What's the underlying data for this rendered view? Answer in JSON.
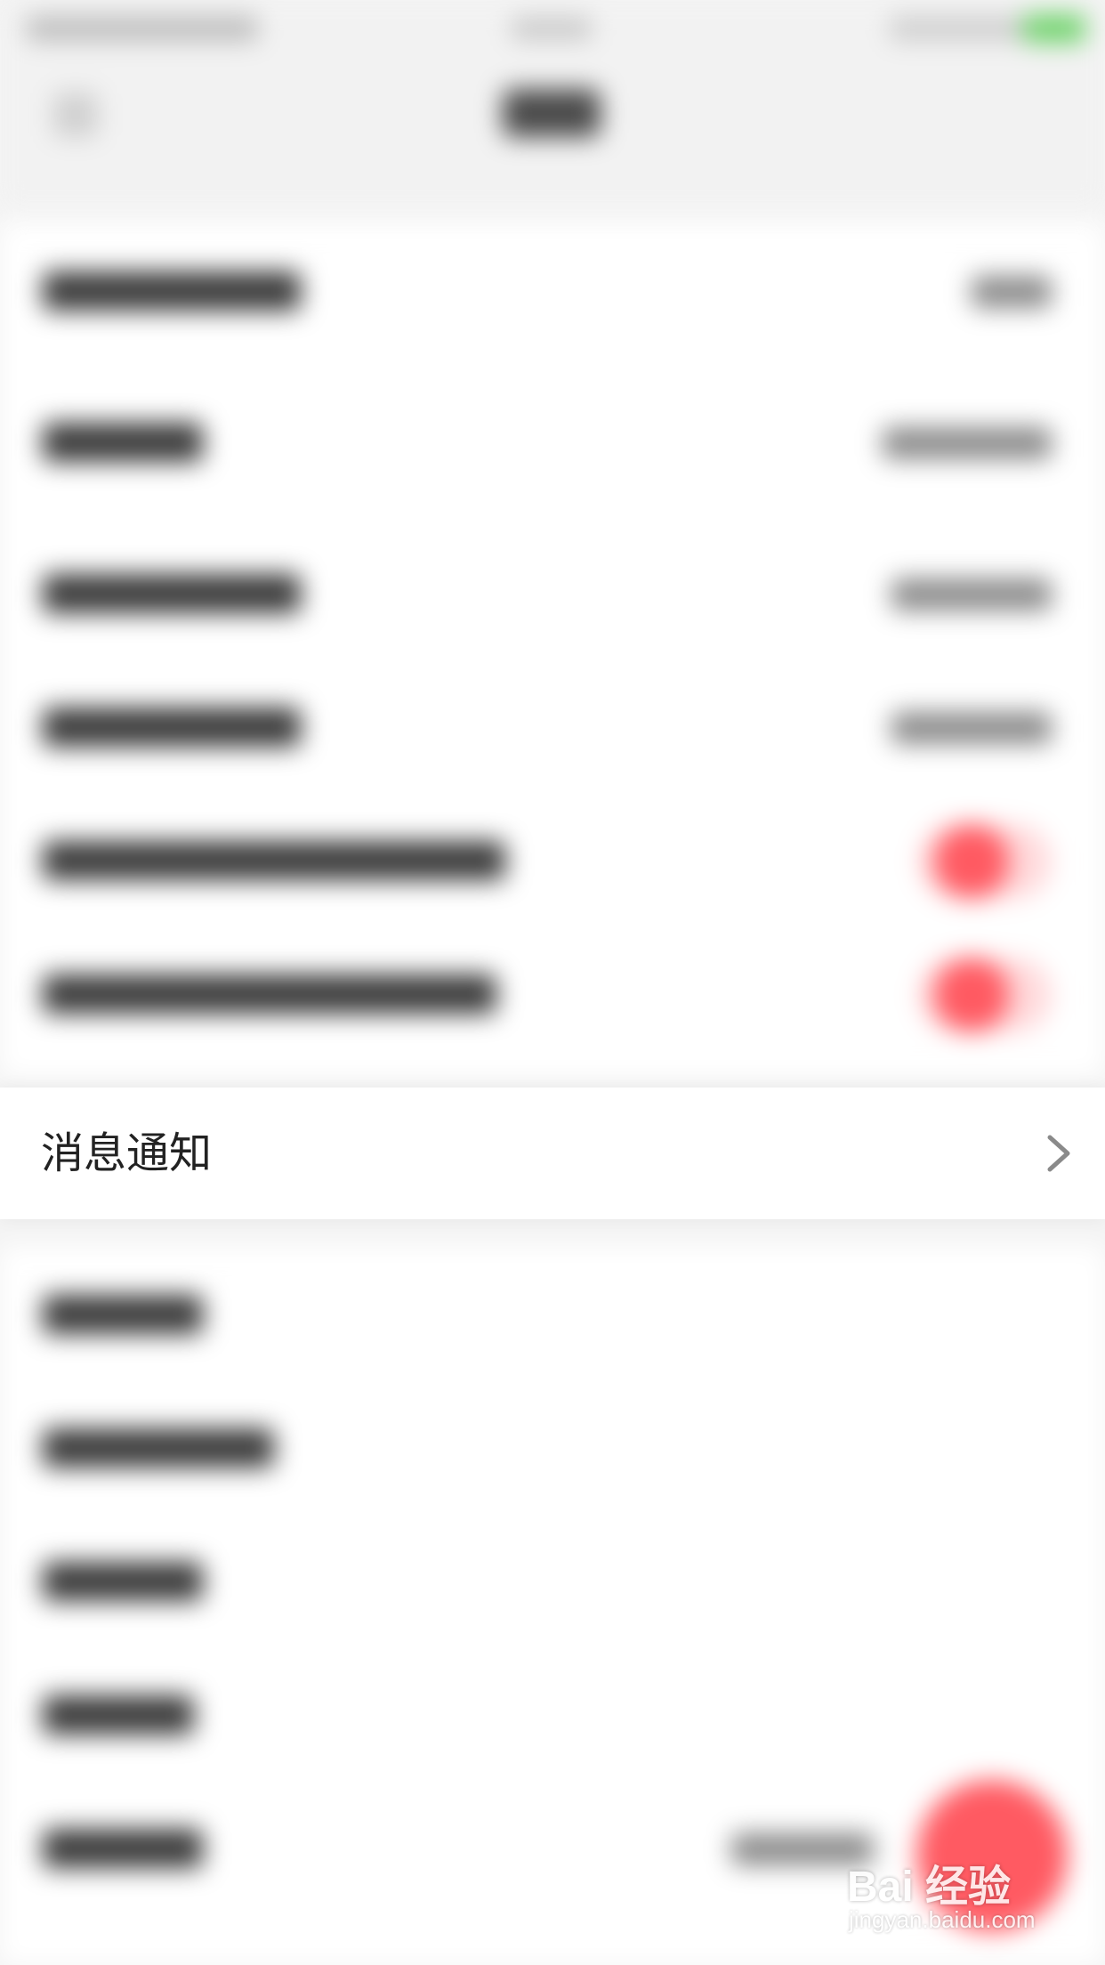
{
  "settings": {
    "notification_row": {
      "label": "消息通知",
      "chevron_icon": "chevron-right-icon"
    }
  },
  "colors": {
    "accent": "#ff5a62",
    "background": "#f4f4f4",
    "row_background": "#ffffff",
    "text_primary": "#222222",
    "chevron": "#8a8a8a"
  },
  "watermark": {
    "brand": "Bai 经验",
    "url": "jingyan.baidu.com"
  }
}
